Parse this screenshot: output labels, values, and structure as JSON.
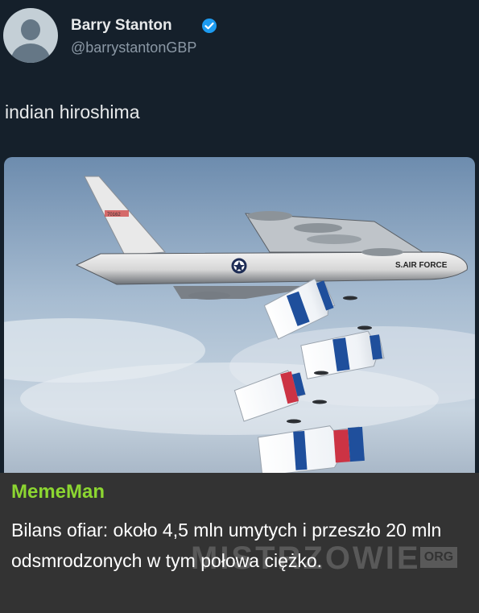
{
  "tweet": {
    "display_name": "Barry Stanton",
    "handle": "@barrystantonGBP",
    "verified_icon": "verified-badge-icon",
    "text": "indian hiroshima",
    "image": {
      "plane_tail_number": "70162",
      "plane_body_text": "S.AIR FORCE"
    }
  },
  "comment": {
    "author": "MemeMan",
    "text": "Bilans ofiar: około 4,5 mln umytych i przeszło 20 mln odsmrodzonych w tym połowa ciężko.",
    "author_color": "#8cd631"
  },
  "watermark": {
    "text": "MISTRZOWIE",
    "suffix": "ORG"
  }
}
